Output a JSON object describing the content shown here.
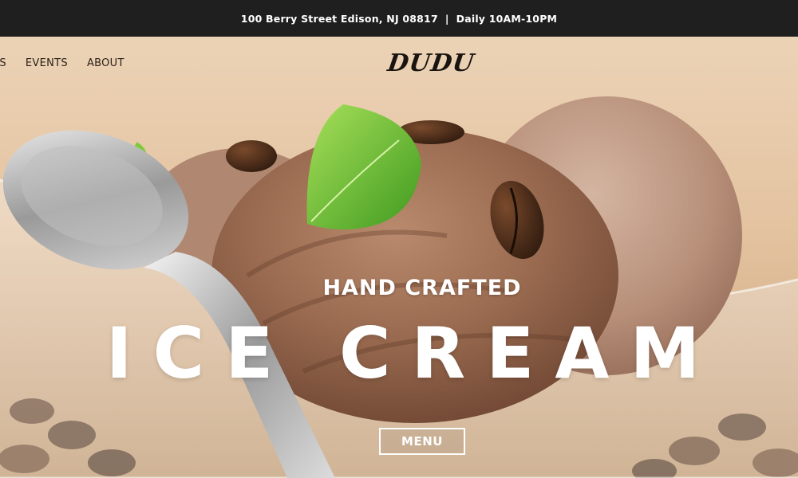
{
  "topbar": {
    "address": "100 Berry Street Edison, NJ 08817",
    "separator": "|",
    "hours": "Daily 10AM-10PM"
  },
  "nav": {
    "items": [
      "RS",
      "EVENTS",
      "ABOUT"
    ]
  },
  "logo": {
    "text": "DUDU"
  },
  "hero": {
    "subtitle": "HAND CRAFTED",
    "title": "ICE CREAM",
    "button_label": "MENU",
    "image_icon": "ice-cream-bowl-photo"
  },
  "colors": {
    "topbar_bg": "#1f1f1f",
    "text_light": "#ffffff",
    "nav_text": "#2a2018",
    "background": "#e7c9a8"
  }
}
